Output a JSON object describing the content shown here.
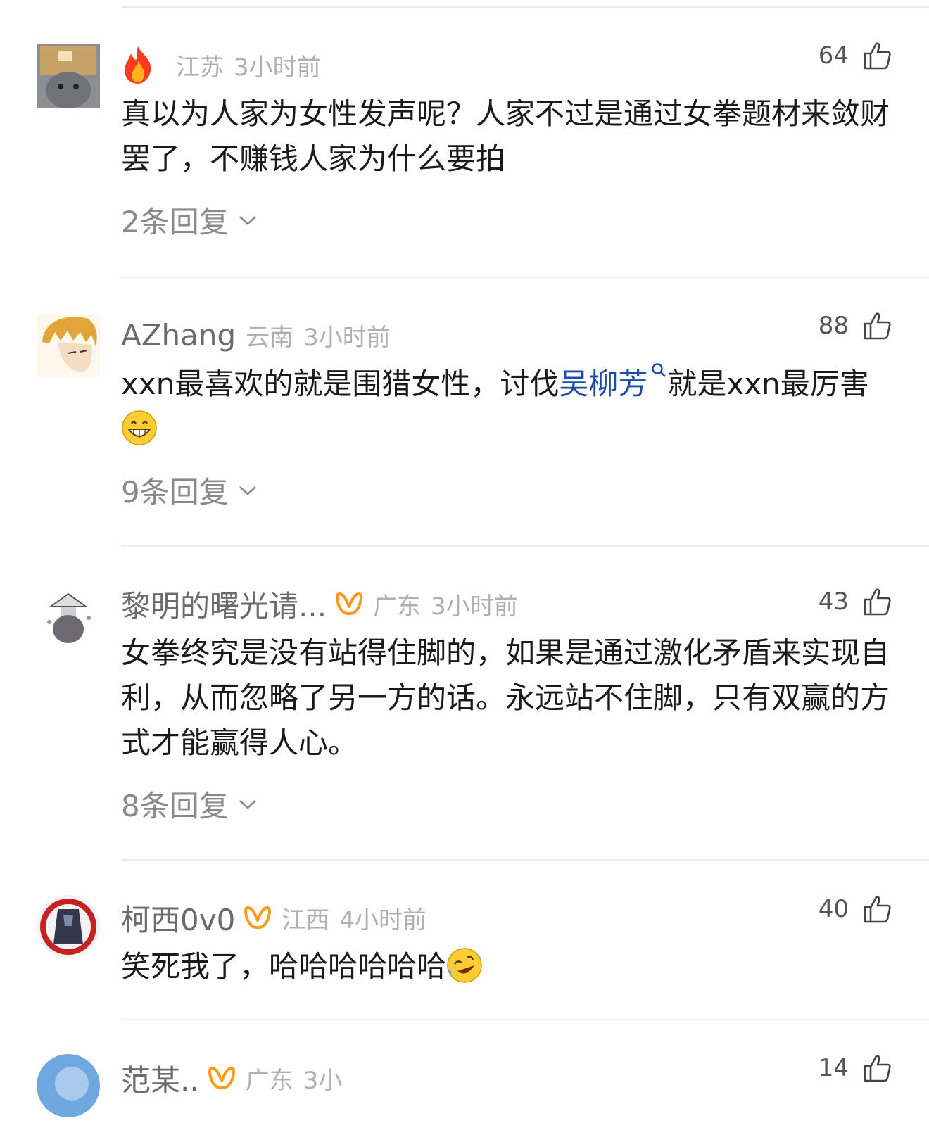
{
  "comments": [
    {
      "username": "",
      "location": "江苏",
      "time": "3小时前",
      "likes": "64",
      "text": "真以为人家为女性发声呢？人家不过是通过女拳题材来敛财罢了，不赚钱人家为什么要拍",
      "replies": "2条回复",
      "badge_icon": "fire-icon"
    },
    {
      "username": "AZhang",
      "location": "云南",
      "time": "3小时前",
      "likes": "88",
      "text_before": "xxn最喜欢的就是围猎女性，讨伐",
      "topic": "吴柳芳",
      "text_after": "就是xxn最厉害",
      "replies": "9条回复",
      "emoji": "grinning-face-icon"
    },
    {
      "username": "黎明的曙光请...",
      "location": "广东",
      "time": "3小时前",
      "likes": "43",
      "text": "女拳终究是没有站得住脚的，如果是通过激化矛盾来实现自利，从而忽略了另一方的话。永远站不住脚，只有双赢的方式才能赢得人心。",
      "replies": "8条回复",
      "badge_icon": "vip-icon"
    },
    {
      "username": "柯西0v0",
      "location": "江西",
      "time": "4小时前",
      "likes": "40",
      "text": "笑死我了，哈哈哈哈哈哈",
      "emoji": "rolling-laugh-icon",
      "badge_icon": "vip-icon"
    },
    {
      "username": "范某..",
      "location": "广东",
      "time": "3小",
      "likes": "14",
      "badge_icon": "vip-icon"
    }
  ],
  "colors": {
    "link": "#1c4aa8",
    "vip": "#ff9a1f",
    "username": "#6b6b6b",
    "meta": "#b0b0b0"
  }
}
